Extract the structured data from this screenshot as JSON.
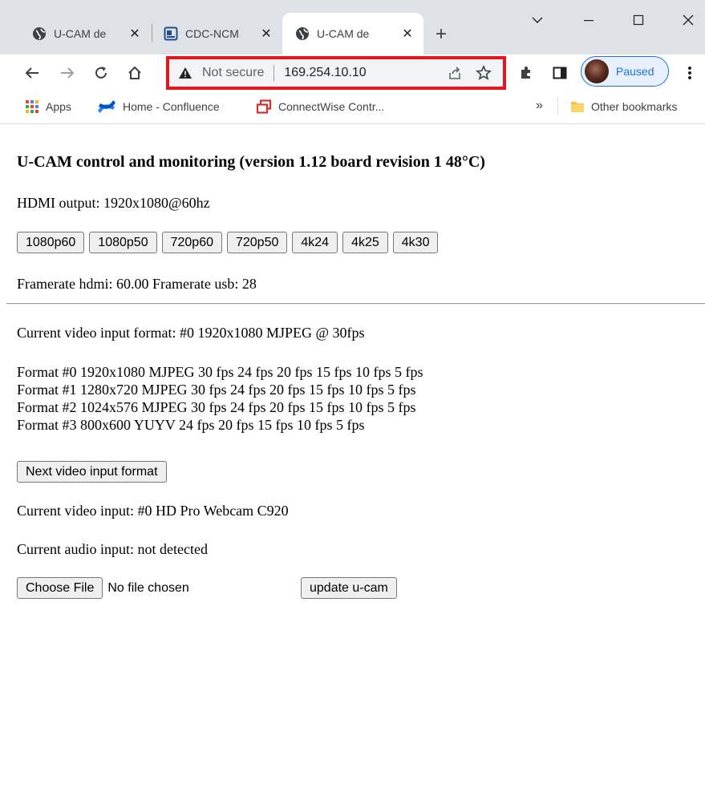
{
  "tabs": [
    {
      "title": "U-CAM de",
      "close": "✕",
      "icon": "globe-icon",
      "active": false
    },
    {
      "title": "CDC-NCM",
      "close": "✕",
      "icon": "doc-icon",
      "active": false
    },
    {
      "title": "U-CAM de",
      "close": "✕",
      "icon": "globe-icon",
      "active": true
    }
  ],
  "new_tab": "+",
  "window_controls": {
    "minimize": "—",
    "maximize": "☐",
    "close": "✕",
    "dropdown": "⌵"
  },
  "omnibox": {
    "security": "Not secure",
    "url": "169.254.10.10"
  },
  "profile": {
    "status": "Paused"
  },
  "bookmarks": {
    "apps": "Apps",
    "items": [
      "Home - Confluence",
      "ConnectWise Contr..."
    ],
    "overflow": "»",
    "other": "Other bookmarks"
  },
  "page": {
    "title": "U-CAM control and monitoring (version 1.12 board revision 1 48°C)",
    "hdmi_output": "HDMI output: 1920x1080@60hz",
    "mode_buttons": [
      "1080p60",
      "1080p50",
      "720p60",
      "720p50",
      "4k24",
      "4k25",
      "4k30"
    ],
    "framerate": "Framerate hdmi: 60.00 Framerate usb: 28",
    "current_format": "Current video input format: #0 1920x1080 MJPEG @ 30fps",
    "formats": [
      "Format #0 1920x1080 MJPEG 30 fps 24 fps 20 fps 15 fps 10 fps 5 fps",
      "Format #1 1280x720 MJPEG 30 fps 24 fps 20 fps 15 fps 10 fps 5 fps",
      "Format #2 1024x576 MJPEG 30 fps 24 fps 20 fps 15 fps 10 fps 5 fps",
      "Format #3 800x600 YUYV 24 fps 20 fps 15 fps 10 fps 5 fps"
    ],
    "next_format_button": "Next video input format",
    "current_video_input": "Current video input: #0 HD Pro Webcam C920",
    "current_audio_input": "Current audio input: not detected",
    "choose_file_button": "Choose File",
    "file_status": "No file chosen",
    "update_button": "update u-cam"
  },
  "colors": {
    "highlight_box": "#e8141c",
    "profile_accent": "#1a73e8",
    "tabstrip": "#dee1e6"
  }
}
